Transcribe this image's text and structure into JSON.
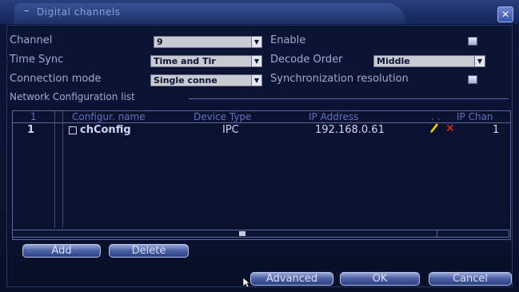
{
  "window": {
    "title": "Digital channels",
    "close_glyph": "✕"
  },
  "form": {
    "channel_label": "Channel",
    "channel_value": "9",
    "enable_label": "Enable",
    "time_sync_label": "Time Sync",
    "time_sync_value": "Time and Tir",
    "decode_order_label": "Decode Order",
    "decode_order_value": "Middle",
    "connection_mode_label": "Connection mode",
    "connection_mode_value": "Single conne",
    "sync_resolution_label": "Synchronization resolution"
  },
  "network_list": {
    "section_label": "Network Configuration list",
    "columns": [
      "Configur. name",
      "Device Type",
      "IP Address",
      "IP Chan"
    ],
    "header_index": "1",
    "header_marks": ". .",
    "rows": [
      {
        "index": "1",
        "name": "chConfig",
        "device_type": "IPC",
        "ip_address": "192.168.0.61",
        "ip_channel": "1"
      }
    ]
  },
  "buttons": {
    "add": "Add",
    "delete": "Delete",
    "advanced": "Advanced",
    "ok": "OK",
    "cancel": "Cancel"
  },
  "colors": {
    "background": "#0a1230",
    "header_text": "#5e73c2",
    "delete_icon": "#ff2a1e",
    "edit_icon": "#f5c400"
  },
  "icons": [
    "close-icon",
    "checkbox-icon",
    "edit-icon",
    "delete-icon",
    "dropdown-arrow-icon",
    "mouse-cursor-icon"
  ]
}
